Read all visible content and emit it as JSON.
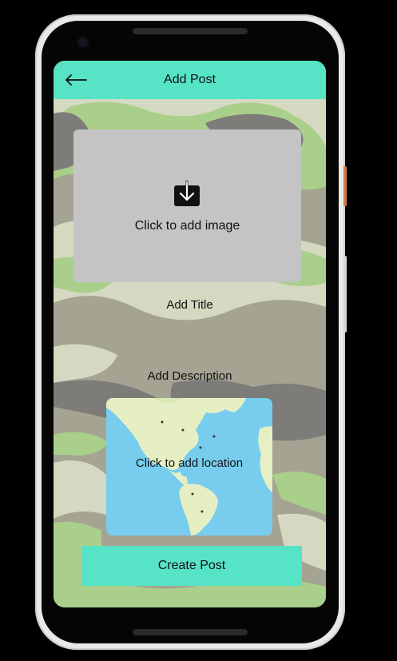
{
  "app_bar": {
    "title": "Add Post",
    "back_icon": "arrow-left-icon"
  },
  "image_picker": {
    "label": "Click to add image",
    "icon": "download-icon"
  },
  "form": {
    "title_placeholder": "Add Title",
    "description_placeholder": "Add Description"
  },
  "location_picker": {
    "label": "Click to add location"
  },
  "actions": {
    "create_label": "Create Post"
  },
  "colors": {
    "accent": "#57e3c6",
    "image_card": "#c4c4c4",
    "map_water": "#78cdee",
    "map_land": "#e6efc4",
    "camo_light": "#d5d9c1",
    "camo_green": "#aacf8b",
    "camo_gray": "#7d7c79",
    "camo_tan": "#a5a493"
  }
}
